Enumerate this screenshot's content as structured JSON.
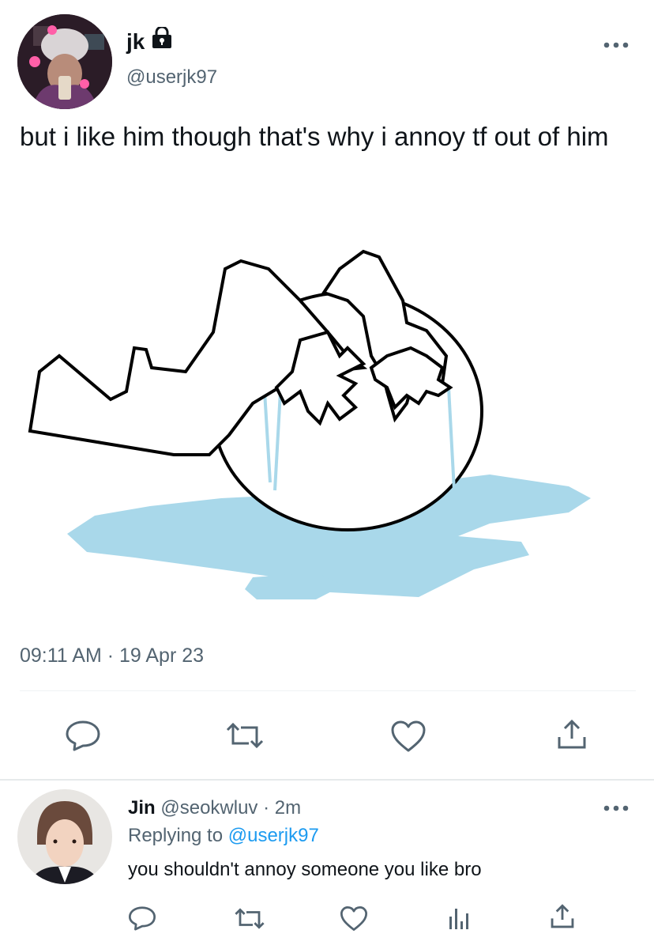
{
  "tweet": {
    "display_name": "jk",
    "protected_icon": "lock-icon",
    "handle": "@userjk97",
    "text": "but i like him though that's why i annoy tf out of him",
    "timestamp": "09:11 AM · 19 Apr 23",
    "more_icon": "more-options-icon",
    "actions": [
      "reply-icon",
      "retweet-icon",
      "like-icon",
      "share-icon"
    ]
  },
  "reply": {
    "display_name": "Jin",
    "handle": "@seokwluv",
    "separator": "·",
    "time": "2m",
    "replying_prefix": "Replying to",
    "replying_handle": "@userjk97",
    "text": "you shouldn't annoy someone you like bro",
    "more_icon": "more-options-icon",
    "actions": [
      "reply-icon",
      "retweet-icon",
      "like-icon",
      "views-icon",
      "share-icon"
    ]
  },
  "colors": {
    "text": "#0f1419",
    "muted": "#536471",
    "accent": "#1d9bf0",
    "tear_blue": "#a9d8ea"
  }
}
